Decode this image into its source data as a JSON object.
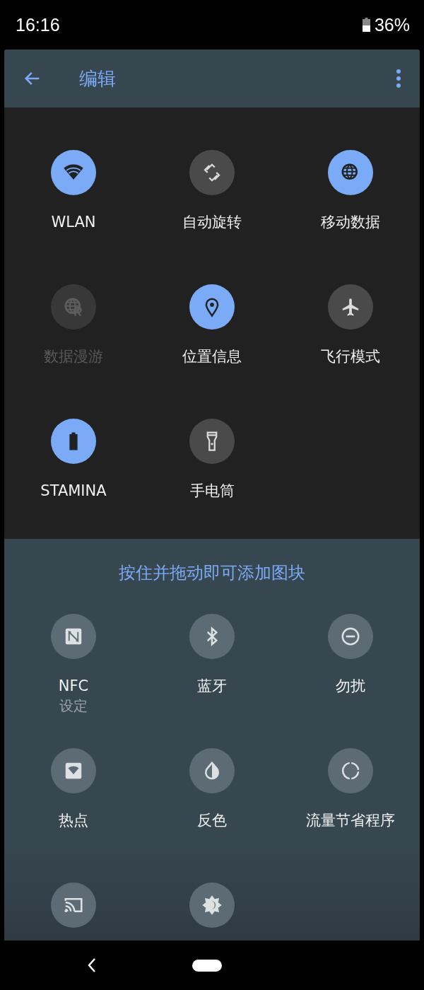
{
  "status_bar": {
    "time": "16:16",
    "battery": "36%"
  },
  "toolbar": {
    "title": "编辑"
  },
  "active_tiles": [
    {
      "label": "WLAN",
      "on": true,
      "disabled": false
    },
    {
      "label": "自动旋转",
      "on": false,
      "disabled": false
    },
    {
      "label": "移动数据",
      "on": true,
      "disabled": false
    },
    {
      "label": "数据漫游",
      "on": false,
      "disabled": true
    },
    {
      "label": "位置信息",
      "on": true,
      "disabled": false
    },
    {
      "label": "飞行模式",
      "on": false,
      "disabled": false
    },
    {
      "label": "STAMINA",
      "on": true,
      "disabled": false
    },
    {
      "label": "手电筒",
      "on": false,
      "disabled": false
    }
  ],
  "available": {
    "hint": "按住并拖动即可添加图块",
    "tiles": [
      {
        "kind": "tile",
        "label": "NFC",
        "subtitle": "设定"
      },
      {
        "kind": "tile",
        "label": "蓝牙"
      },
      {
        "kind": "tile",
        "label": "勿扰"
      },
      {
        "kind": "tile",
        "label": "热点"
      },
      {
        "kind": "tile",
        "label": "反色"
      },
      {
        "kind": "tile",
        "label": "流量节省程序"
      },
      {
        "kind": "tile"
      },
      {
        "kind": "tile"
      }
    ]
  }
}
